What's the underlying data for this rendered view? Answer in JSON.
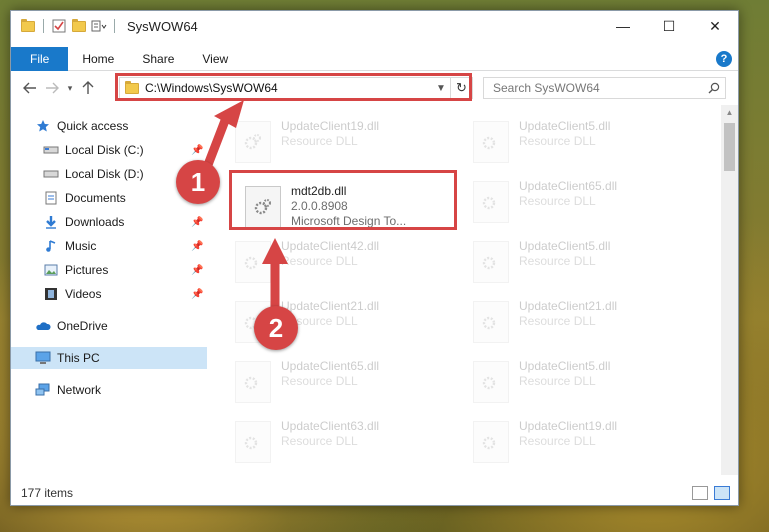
{
  "window": {
    "title": "SysWOW64",
    "controls": {
      "minimize": "—",
      "maximize": "☐",
      "close": "✕"
    }
  },
  "ribbon": {
    "tabs": [
      "File",
      "Home",
      "Share",
      "View"
    ],
    "help": "?"
  },
  "nav": {
    "address": "C:\\Windows\\SysWOW64",
    "search_placeholder": "Search SysWOW64"
  },
  "sidebar": {
    "items": [
      {
        "label": "Quick access",
        "icon": "star-icon"
      },
      {
        "label": "Local Disk (C:)",
        "icon": "drive-icon",
        "pinned": true
      },
      {
        "label": "Local Disk (D:)",
        "icon": "drive-icon",
        "pinned": false
      },
      {
        "label": "Documents",
        "icon": "documents-icon",
        "pinned": true
      },
      {
        "label": "Downloads",
        "icon": "download-icon",
        "pinned": true
      },
      {
        "label": "Music",
        "icon": "music-icon",
        "pinned": true
      },
      {
        "label": "Pictures",
        "icon": "pictures-icon",
        "pinned": true
      },
      {
        "label": "Videos",
        "icon": "videos-icon",
        "pinned": true
      },
      {
        "label": "OneDrive",
        "icon": "cloud-icon"
      },
      {
        "label": "This PC",
        "icon": "computer-icon",
        "selected": true
      },
      {
        "label": "Network",
        "icon": "network-icon"
      }
    ]
  },
  "files": {
    "left": [
      {
        "name": "UpdateClient19.dll",
        "sub": "Resource DLL"
      },
      {
        "name": "mdt2db.dll",
        "sub": "2.0.0.8908",
        "sub2": "Microsoft Design To...",
        "highlight": true
      },
      {
        "name": "UpdateClient42.dll",
        "sub": "Resource DLL"
      },
      {
        "name": "UpdateClient21.dll",
        "sub": "Resource DLL"
      },
      {
        "name": "UpdateClient65.dll",
        "sub": "Resource DLL"
      },
      {
        "name": "UpdateClient63.dll",
        "sub": "Resource DLL"
      }
    ],
    "right": [
      {
        "name": "UpdateClient5.dll",
        "sub": "Resource DLL"
      },
      {
        "name": "UpdateClient65.dll",
        "sub": "Resource DLL"
      },
      {
        "name": "UpdateClient5.dll",
        "sub": "Resource DLL"
      },
      {
        "name": "UpdateClient21.dll",
        "sub": "Resource DLL"
      },
      {
        "name": "UpdateClient5.dll",
        "sub": "Resource DLL"
      },
      {
        "name": "UpdateClient19.dll",
        "sub": "Resource DLL"
      }
    ]
  },
  "status": {
    "item_count": "177 items"
  },
  "callouts": {
    "step1": "1",
    "step2": "2"
  },
  "colors": {
    "accent": "#1979ca",
    "highlight": "#d64545",
    "selected": "#cce4f7"
  }
}
